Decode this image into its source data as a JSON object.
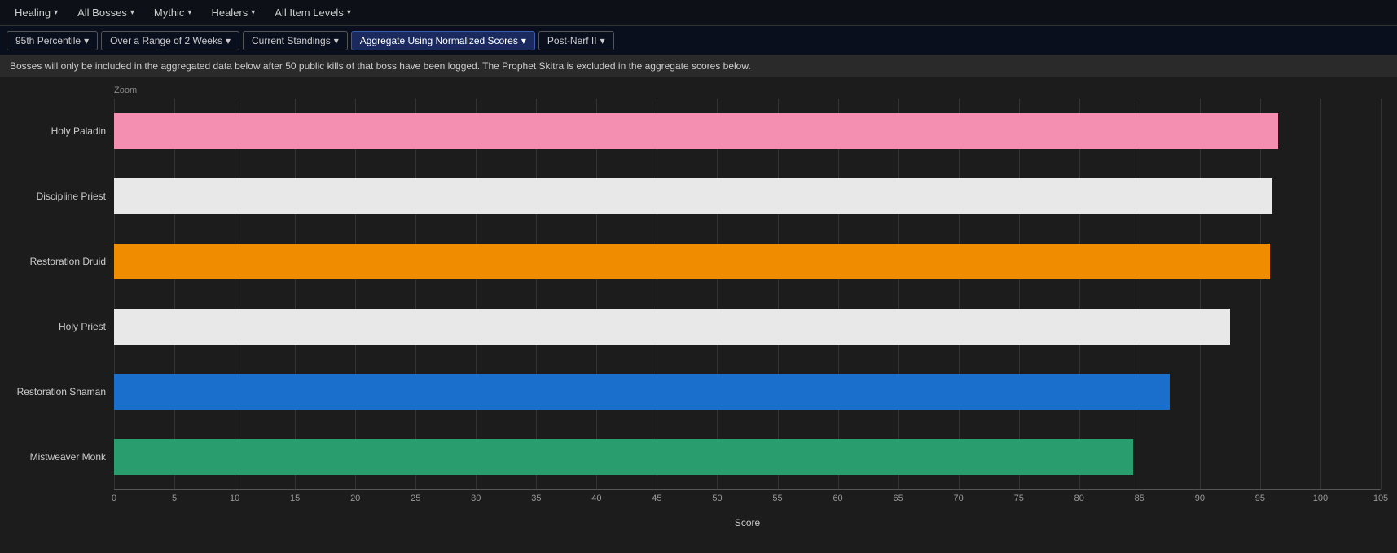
{
  "topNav": {
    "items": [
      {
        "label": "Healing",
        "caret": "▾",
        "id": "healing"
      },
      {
        "label": "All Bosses",
        "caret": "▾",
        "id": "all-bosses"
      },
      {
        "label": "Mythic",
        "caret": "▾",
        "id": "mythic"
      },
      {
        "label": "Healers",
        "caret": "▾",
        "id": "healers"
      },
      {
        "label": "All Item Levels",
        "caret": "▾",
        "id": "all-item-levels"
      }
    ]
  },
  "secondNav": {
    "items": [
      {
        "label": "95th Percentile",
        "caret": "▾",
        "id": "percentile"
      },
      {
        "label": "Over a Range of 2 Weeks",
        "caret": "▾",
        "id": "weeks"
      },
      {
        "label": "Current Standings",
        "caret": "▾",
        "id": "standings",
        "active": false
      },
      {
        "label": "Aggregate Using Normalized Scores",
        "caret": "▾",
        "id": "aggregate",
        "active": true
      },
      {
        "label": "Post-Nerf II",
        "caret": "▾",
        "id": "post-nerf"
      }
    ]
  },
  "infoBar": {
    "text": "Bosses will only be included in the aggregated data below after 50 public kills of that boss have been logged. The Prophet Skitra is excluded in the aggregate scores below."
  },
  "chart": {
    "zoomLabel": "Zoom",
    "xAxisLabel": "Score",
    "xTicks": [
      0,
      5,
      10,
      15,
      20,
      25,
      30,
      35,
      40,
      45,
      50,
      55,
      60,
      65,
      70,
      75,
      80,
      85,
      90,
      95,
      100,
      105
    ],
    "maxValue": 105,
    "bars": [
      {
        "label": "Holy Paladin",
        "value": 96.5,
        "color": "#f48fb1",
        "pct": 91.9
      },
      {
        "label": "Discipline Priest",
        "value": 96.0,
        "color": "#e8e8e8",
        "pct": 91.4
      },
      {
        "label": "Restoration Druid",
        "value": 95.8,
        "color": "#f08c00",
        "pct": 91.2
      },
      {
        "label": "Holy Priest",
        "value": 92.5,
        "color": "#e8e8e8",
        "pct": 88.1
      },
      {
        "label": "Restoration Shaman",
        "value": 87.5,
        "color": "#1a6ecc",
        "pct": 83.3
      },
      {
        "label": "Mistweaver Monk",
        "value": 84.5,
        "color": "#2a9d6e",
        "pct": 80.5
      }
    ]
  }
}
